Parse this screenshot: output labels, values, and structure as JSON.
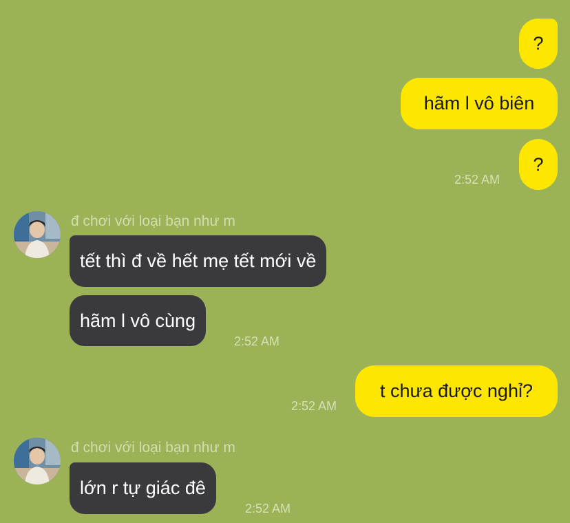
{
  "colors": {
    "background": "#9bb257",
    "outgoing_bubble": "#fde600",
    "incoming_bubble": "#3a3a3e"
  },
  "messages": [
    {
      "text": "?"
    },
    {
      "text": "hãm l vô biên"
    },
    {
      "text": "?",
      "time": "2:52 AM"
    },
    {
      "sender": "đ chơi với loại bạn như m",
      "text": "tết thì đ về hết mẹ tết mới về"
    },
    {
      "text": "hãm l vô cùng",
      "time": "2:52 AM"
    },
    {
      "text": "t chưa được nghỉ?",
      "time": "2:52 AM"
    },
    {
      "sender": "đ chơi với loại bạn như m",
      "text": "lớn r tự giác đê",
      "time": "2:52 AM"
    }
  ]
}
